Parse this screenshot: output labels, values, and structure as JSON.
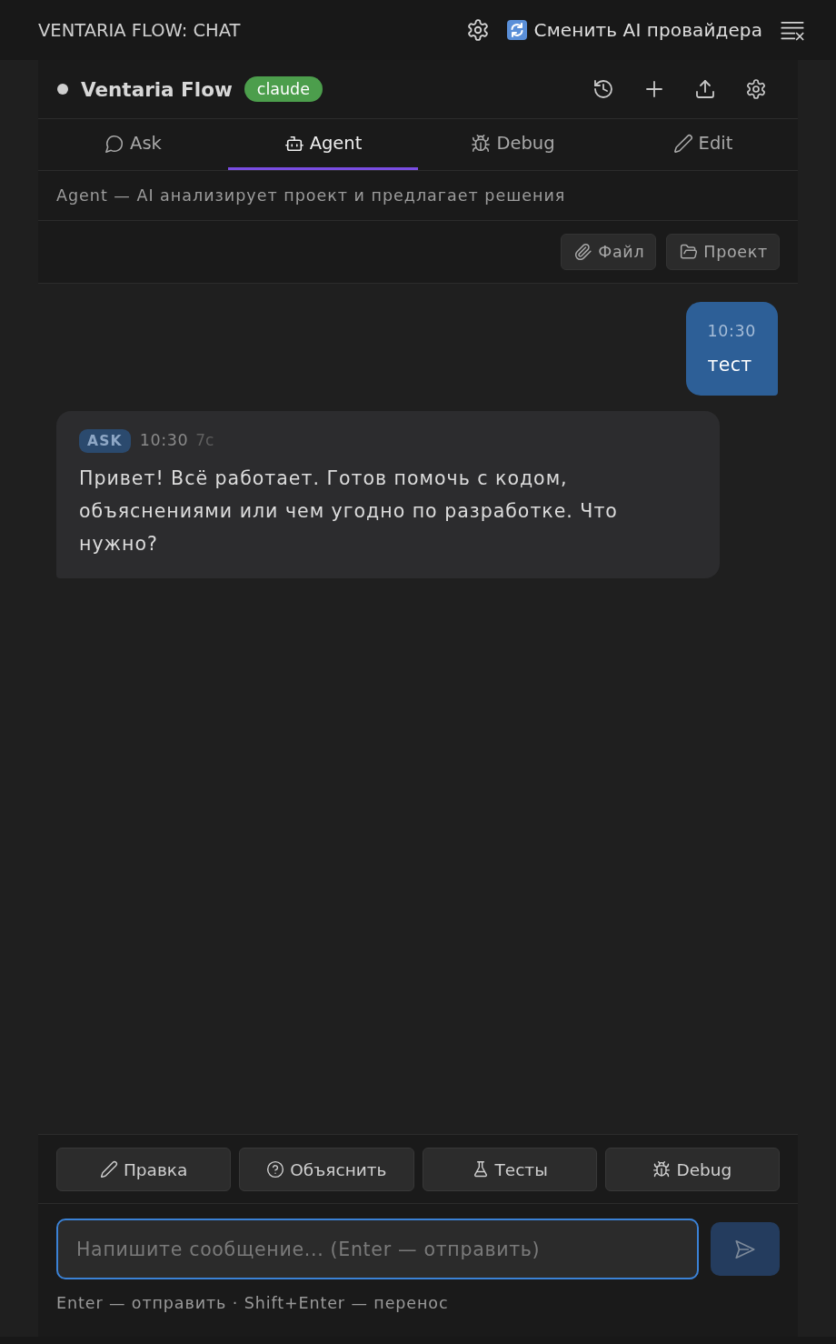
{
  "window": {
    "title": "VENTARIA FLOW: CHAT",
    "provider_button": "Сменить AI провайдера"
  },
  "header": {
    "name": "Ventaria Flow",
    "badge": "claude"
  },
  "tabs": [
    {
      "label": "Ask",
      "selected": false
    },
    {
      "label": "Agent",
      "selected": true
    },
    {
      "label": "Debug",
      "selected": false
    },
    {
      "label": "Edit",
      "selected": false
    }
  ],
  "mode_hint": "Agent — AI анализирует проект и предлагает решения",
  "attach_buttons": [
    {
      "label": "Файл"
    },
    {
      "label": "Проект"
    }
  ],
  "messages": [
    {
      "kind": "user",
      "time": "10:30",
      "text": "тест"
    },
    {
      "kind": "assistant",
      "badge": "ASK",
      "time": "10:30",
      "duration": "7с",
      "text": "Привет! Всё работает. Готов помочь с кодом, объяснениями или чем угодно по разработке. Что нужно?"
    }
  ],
  "quick_actions": [
    {
      "label": "Правка"
    },
    {
      "label": "Объяснить"
    },
    {
      "label": "Тесты"
    },
    {
      "label": "Debug"
    }
  ],
  "composer": {
    "placeholder": "Напишите сообщение... (Enter — отправить)",
    "focused": true,
    "send_disabled": true,
    "hint": "Enter — отправить · Shift+Enter — перенос"
  }
}
